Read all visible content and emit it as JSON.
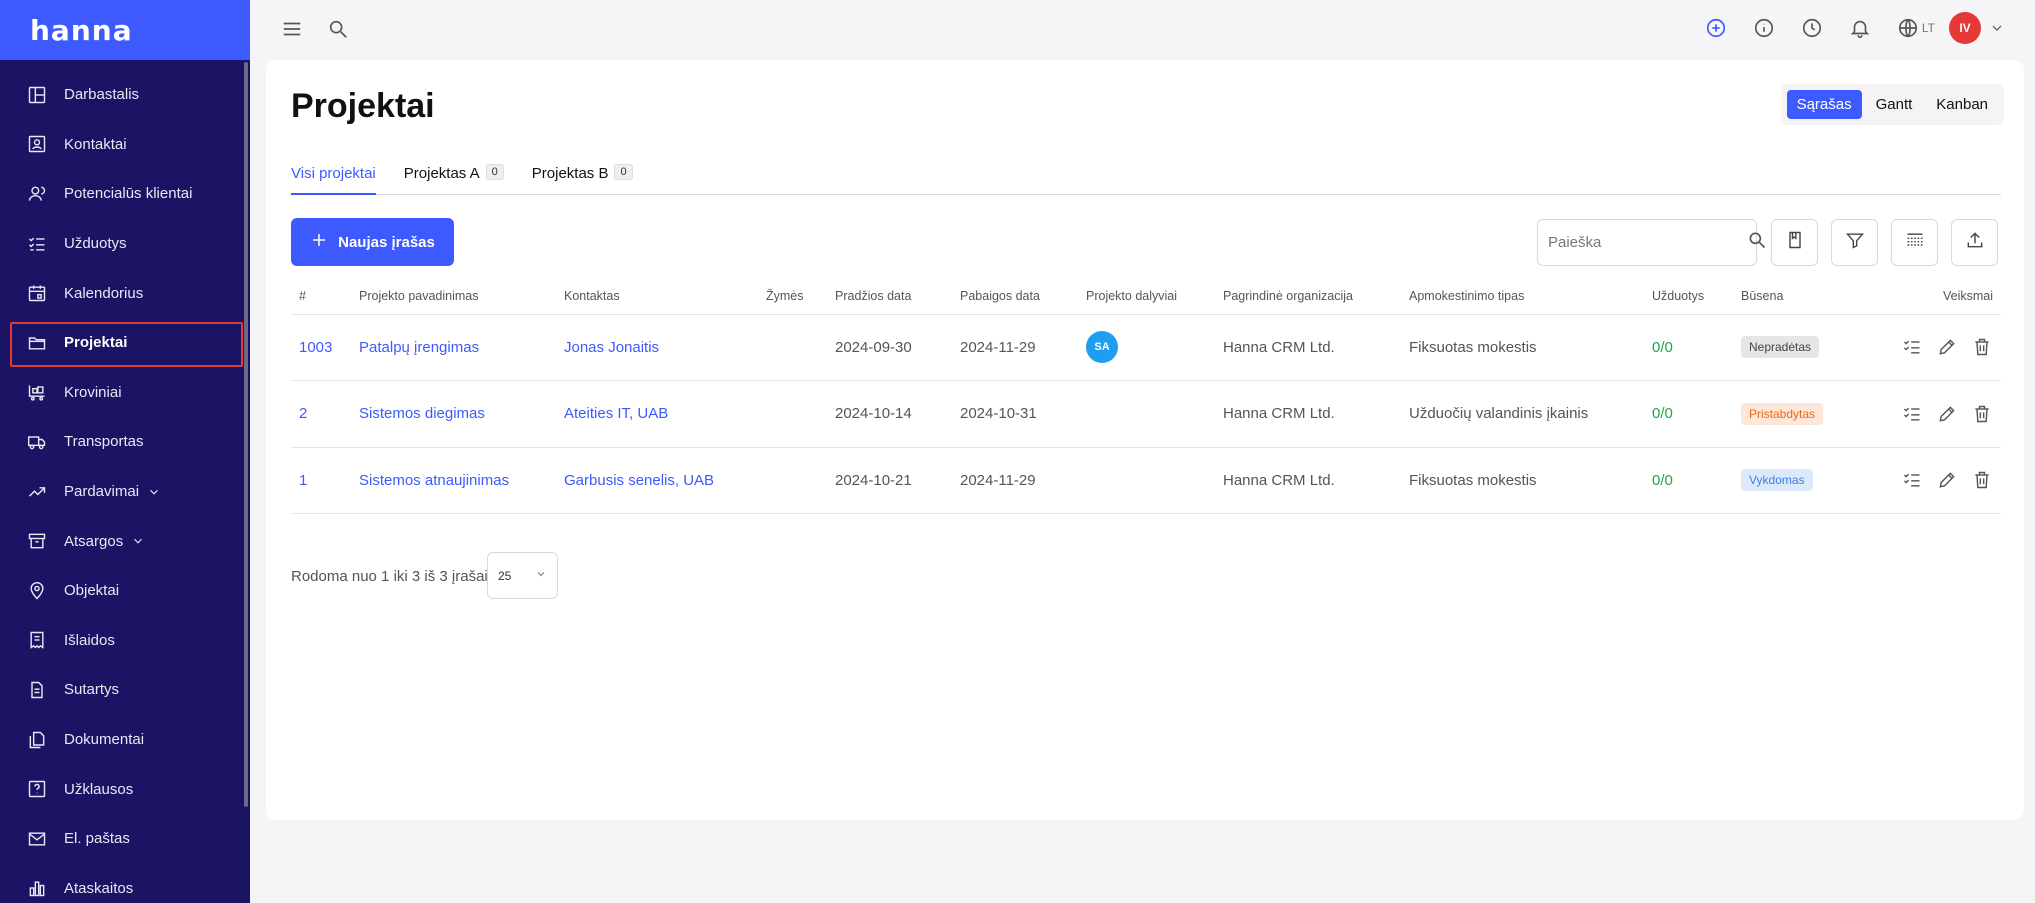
{
  "brand": {
    "logo": "hanna",
    "accent": "#3d5afe",
    "sidebar_bg": "#1b1464"
  },
  "sidebar": {
    "items": [
      {
        "label": "Darbastalis",
        "icon": "dashboard-icon"
      },
      {
        "label": "Kontaktai",
        "icon": "contact-card-icon"
      },
      {
        "label": "Potencialūs klientai",
        "icon": "leads-icon"
      },
      {
        "label": "Užduotys",
        "icon": "tasks-icon"
      },
      {
        "label": "Kalendorius",
        "icon": "calendar-icon"
      },
      {
        "label": "Projektai",
        "icon": "folder-icon",
        "active": true
      },
      {
        "label": "Kroviniai",
        "icon": "cart-icon"
      },
      {
        "label": "Transportas",
        "icon": "truck-icon"
      },
      {
        "label": "Pardavimai",
        "icon": "trend-icon",
        "expandable": true
      },
      {
        "label": "Atsargos",
        "icon": "archive-icon",
        "expandable": true
      },
      {
        "label": "Objektai",
        "icon": "map-pin-icon"
      },
      {
        "label": "Išlaidos",
        "icon": "receipt-icon"
      },
      {
        "label": "Sutartys",
        "icon": "document-icon"
      },
      {
        "label": "Dokumentai",
        "icon": "documents-icon"
      },
      {
        "label": "Užklausos",
        "icon": "question-icon"
      },
      {
        "label": "El. paštas",
        "icon": "mail-icon"
      },
      {
        "label": "Ataskaitos",
        "icon": "bar-chart-icon"
      }
    ]
  },
  "topbar": {
    "language": "LT",
    "user_initials": "IV"
  },
  "page": {
    "title": "Projektai"
  },
  "views": {
    "list": "Sąrašas",
    "gantt": "Gantt",
    "kanban": "Kanban"
  },
  "tabs": [
    {
      "label": "Visi projektai",
      "count": null
    },
    {
      "label": "Projektas A",
      "count": "0"
    },
    {
      "label": "Projektas B",
      "count": "0"
    }
  ],
  "toolbar": {
    "new_label": "Naujas įrašas",
    "search_placeholder": "Paieška"
  },
  "table": {
    "headers": [
      "#",
      "Projekto pavadinimas",
      "Kontaktas",
      "Žymės",
      "Pradžios data",
      "Pabaigos data",
      "Projekto dalyviai",
      "Pagrindinė organizacija",
      "Apmokestinimo tipas",
      "Užduotys",
      "Būsena",
      "Veiksmai"
    ],
    "rows": [
      {
        "id": "1003",
        "name": "Patalpų įrengimas",
        "contact": "Jonas Jonaitis",
        "tags": "",
        "start": "2024-09-30",
        "end": "2024-11-29",
        "participants": "SA",
        "org": "Hanna CRM Ltd.",
        "billing": "Fiksuotas mokestis",
        "tasks": "0/0",
        "status": "Nepradėtas",
        "status_kind": "grey"
      },
      {
        "id": "2",
        "name": "Sistemos diegimas",
        "contact": "Ateities IT, UAB",
        "tags": "",
        "start": "2024-10-14",
        "end": "2024-10-31",
        "participants": "",
        "org": "Hanna CRM Ltd.",
        "billing": "Užduočių valandinis įkainis",
        "tasks": "0/0",
        "status": "Pristabdytas",
        "status_kind": "orange"
      },
      {
        "id": "1",
        "name": "Sistemos atnaujinimas",
        "contact": "Garbusis senelis, UAB",
        "tags": "",
        "start": "2024-10-21",
        "end": "2024-11-29",
        "participants": "",
        "org": "Hanna CRM Ltd.",
        "billing": "Fiksuotas mokestis",
        "tasks": "0/0",
        "status": "Vykdomas",
        "status_kind": "blue"
      }
    ]
  },
  "pagination": {
    "info": "Rodoma nuo 1 iki 3 iš 3 įrašai",
    "page_size": "25"
  }
}
